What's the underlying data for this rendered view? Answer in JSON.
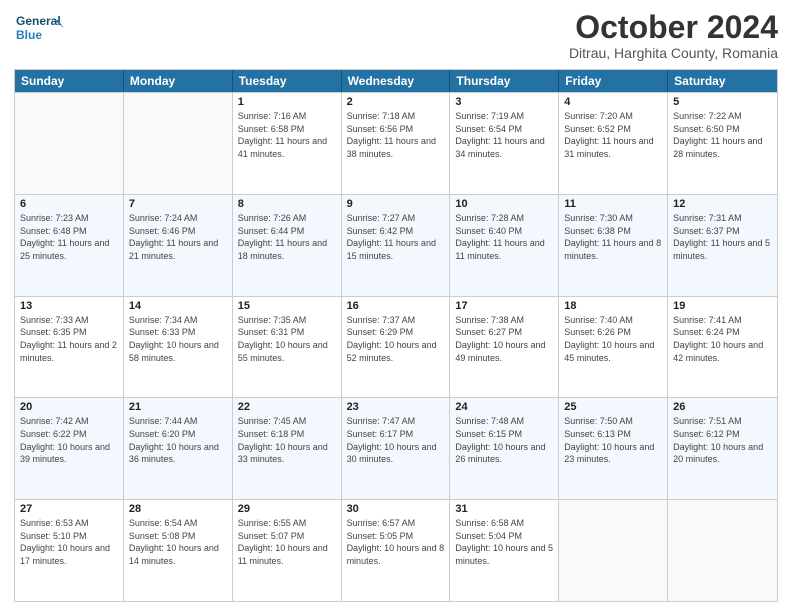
{
  "header": {
    "logo_line1": "General",
    "logo_line2": "Blue",
    "title": "October 2024",
    "subtitle": "Ditrau, Harghita County, Romania"
  },
  "days": [
    "Sunday",
    "Monday",
    "Tuesday",
    "Wednesday",
    "Thursday",
    "Friday",
    "Saturday"
  ],
  "weeks": [
    [
      {
        "date": "",
        "sunrise": "",
        "sunset": "",
        "daylight": ""
      },
      {
        "date": "",
        "sunrise": "",
        "sunset": "",
        "daylight": ""
      },
      {
        "date": "1",
        "sunrise": "Sunrise: 7:16 AM",
        "sunset": "Sunset: 6:58 PM",
        "daylight": "Daylight: 11 hours and 41 minutes."
      },
      {
        "date": "2",
        "sunrise": "Sunrise: 7:18 AM",
        "sunset": "Sunset: 6:56 PM",
        "daylight": "Daylight: 11 hours and 38 minutes."
      },
      {
        "date": "3",
        "sunrise": "Sunrise: 7:19 AM",
        "sunset": "Sunset: 6:54 PM",
        "daylight": "Daylight: 11 hours and 34 minutes."
      },
      {
        "date": "4",
        "sunrise": "Sunrise: 7:20 AM",
        "sunset": "Sunset: 6:52 PM",
        "daylight": "Daylight: 11 hours and 31 minutes."
      },
      {
        "date": "5",
        "sunrise": "Sunrise: 7:22 AM",
        "sunset": "Sunset: 6:50 PM",
        "daylight": "Daylight: 11 hours and 28 minutes."
      }
    ],
    [
      {
        "date": "6",
        "sunrise": "Sunrise: 7:23 AM",
        "sunset": "Sunset: 6:48 PM",
        "daylight": "Daylight: 11 hours and 25 minutes."
      },
      {
        "date": "7",
        "sunrise": "Sunrise: 7:24 AM",
        "sunset": "Sunset: 6:46 PM",
        "daylight": "Daylight: 11 hours and 21 minutes."
      },
      {
        "date": "8",
        "sunrise": "Sunrise: 7:26 AM",
        "sunset": "Sunset: 6:44 PM",
        "daylight": "Daylight: 11 hours and 18 minutes."
      },
      {
        "date": "9",
        "sunrise": "Sunrise: 7:27 AM",
        "sunset": "Sunset: 6:42 PM",
        "daylight": "Daylight: 11 hours and 15 minutes."
      },
      {
        "date": "10",
        "sunrise": "Sunrise: 7:28 AM",
        "sunset": "Sunset: 6:40 PM",
        "daylight": "Daylight: 11 hours and 11 minutes."
      },
      {
        "date": "11",
        "sunrise": "Sunrise: 7:30 AM",
        "sunset": "Sunset: 6:38 PM",
        "daylight": "Daylight: 11 hours and 8 minutes."
      },
      {
        "date": "12",
        "sunrise": "Sunrise: 7:31 AM",
        "sunset": "Sunset: 6:37 PM",
        "daylight": "Daylight: 11 hours and 5 minutes."
      }
    ],
    [
      {
        "date": "13",
        "sunrise": "Sunrise: 7:33 AM",
        "sunset": "Sunset: 6:35 PM",
        "daylight": "Daylight: 11 hours and 2 minutes."
      },
      {
        "date": "14",
        "sunrise": "Sunrise: 7:34 AM",
        "sunset": "Sunset: 6:33 PM",
        "daylight": "Daylight: 10 hours and 58 minutes."
      },
      {
        "date": "15",
        "sunrise": "Sunrise: 7:35 AM",
        "sunset": "Sunset: 6:31 PM",
        "daylight": "Daylight: 10 hours and 55 minutes."
      },
      {
        "date": "16",
        "sunrise": "Sunrise: 7:37 AM",
        "sunset": "Sunset: 6:29 PM",
        "daylight": "Daylight: 10 hours and 52 minutes."
      },
      {
        "date": "17",
        "sunrise": "Sunrise: 7:38 AM",
        "sunset": "Sunset: 6:27 PM",
        "daylight": "Daylight: 10 hours and 49 minutes."
      },
      {
        "date": "18",
        "sunrise": "Sunrise: 7:40 AM",
        "sunset": "Sunset: 6:26 PM",
        "daylight": "Daylight: 10 hours and 45 minutes."
      },
      {
        "date": "19",
        "sunrise": "Sunrise: 7:41 AM",
        "sunset": "Sunset: 6:24 PM",
        "daylight": "Daylight: 10 hours and 42 minutes."
      }
    ],
    [
      {
        "date": "20",
        "sunrise": "Sunrise: 7:42 AM",
        "sunset": "Sunset: 6:22 PM",
        "daylight": "Daylight: 10 hours and 39 minutes."
      },
      {
        "date": "21",
        "sunrise": "Sunrise: 7:44 AM",
        "sunset": "Sunset: 6:20 PM",
        "daylight": "Daylight: 10 hours and 36 minutes."
      },
      {
        "date": "22",
        "sunrise": "Sunrise: 7:45 AM",
        "sunset": "Sunset: 6:18 PM",
        "daylight": "Daylight: 10 hours and 33 minutes."
      },
      {
        "date": "23",
        "sunrise": "Sunrise: 7:47 AM",
        "sunset": "Sunset: 6:17 PM",
        "daylight": "Daylight: 10 hours and 30 minutes."
      },
      {
        "date": "24",
        "sunrise": "Sunrise: 7:48 AM",
        "sunset": "Sunset: 6:15 PM",
        "daylight": "Daylight: 10 hours and 26 minutes."
      },
      {
        "date": "25",
        "sunrise": "Sunrise: 7:50 AM",
        "sunset": "Sunset: 6:13 PM",
        "daylight": "Daylight: 10 hours and 23 minutes."
      },
      {
        "date": "26",
        "sunrise": "Sunrise: 7:51 AM",
        "sunset": "Sunset: 6:12 PM",
        "daylight": "Daylight: 10 hours and 20 minutes."
      }
    ],
    [
      {
        "date": "27",
        "sunrise": "Sunrise: 6:53 AM",
        "sunset": "Sunset: 5:10 PM",
        "daylight": "Daylight: 10 hours and 17 minutes."
      },
      {
        "date": "28",
        "sunrise": "Sunrise: 6:54 AM",
        "sunset": "Sunset: 5:08 PM",
        "daylight": "Daylight: 10 hours and 14 minutes."
      },
      {
        "date": "29",
        "sunrise": "Sunrise: 6:55 AM",
        "sunset": "Sunset: 5:07 PM",
        "daylight": "Daylight: 10 hours and 11 minutes."
      },
      {
        "date": "30",
        "sunrise": "Sunrise: 6:57 AM",
        "sunset": "Sunset: 5:05 PM",
        "daylight": "Daylight: 10 hours and 8 minutes."
      },
      {
        "date": "31",
        "sunrise": "Sunrise: 6:58 AM",
        "sunset": "Sunset: 5:04 PM",
        "daylight": "Daylight: 10 hours and 5 minutes."
      },
      {
        "date": "",
        "sunrise": "",
        "sunset": "",
        "daylight": ""
      },
      {
        "date": "",
        "sunrise": "",
        "sunset": "",
        "daylight": ""
      }
    ]
  ]
}
